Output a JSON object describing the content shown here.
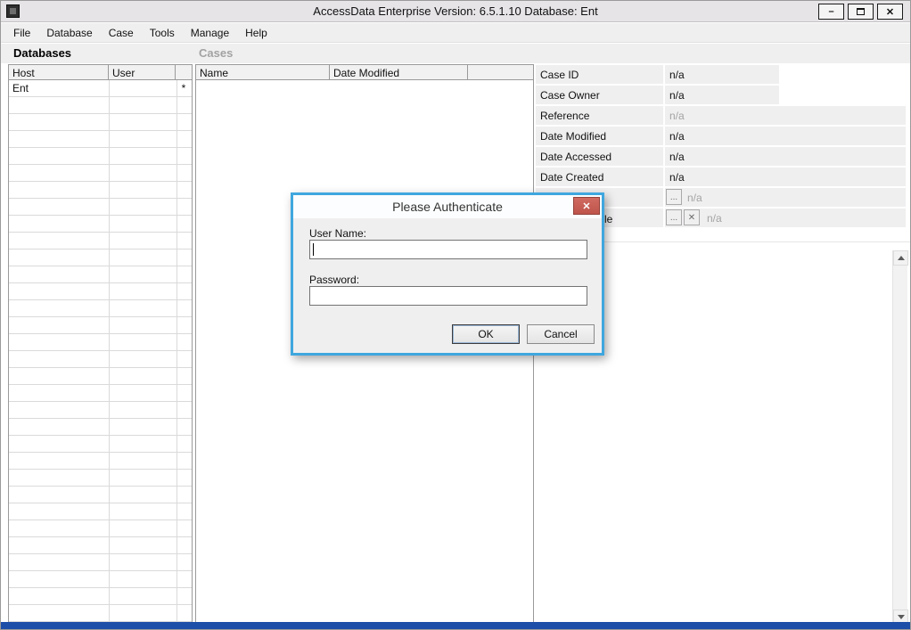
{
  "window": {
    "title": "AccessData Enterprise Version: 6.5.1.10 Database: Ent",
    "icons": {
      "minimize": "–",
      "close": "✕"
    }
  },
  "menu": {
    "items": [
      "File",
      "Database",
      "Case",
      "Tools",
      "Manage",
      "Help"
    ]
  },
  "databases_panel": {
    "title": "Databases",
    "columns": [
      "Host",
      "User"
    ],
    "rows": [
      {
        "host": "Ent",
        "user": "",
        "flag": "*"
      }
    ]
  },
  "cases_panel": {
    "title": "Cases",
    "columns": [
      "Name",
      "Date Modified"
    ]
  },
  "details_panel": {
    "fields": [
      {
        "label": "Case ID",
        "value": "n/a"
      },
      {
        "label": "Case Owner",
        "value": "n/a"
      },
      {
        "label": "Reference",
        "value": "n/a"
      },
      {
        "label": "Date Modified",
        "value": "n/a"
      },
      {
        "label": "Date Accessed",
        "value": "n/a"
      },
      {
        "label": "Date Created",
        "value": "n/a"
      },
      {
        "label": "",
        "value": "n/a",
        "browse": "..."
      },
      {
        "label_fragment": "le",
        "value": "n/a",
        "browse": "...",
        "clear": "✕"
      }
    ]
  },
  "dialog": {
    "title": "Please Authenticate",
    "close_icon": "✕",
    "username_label": "User Name:",
    "username_value": "",
    "password_label": "Password:",
    "password_value": "",
    "ok_label": "OK",
    "cancel_label": "Cancel"
  },
  "colors": {
    "dialog_border": "#3FA7DE",
    "dialog_close": "#BF544B",
    "bottom_bar": "#1D4EA8",
    "panel_gray": "#F0EFF0"
  }
}
